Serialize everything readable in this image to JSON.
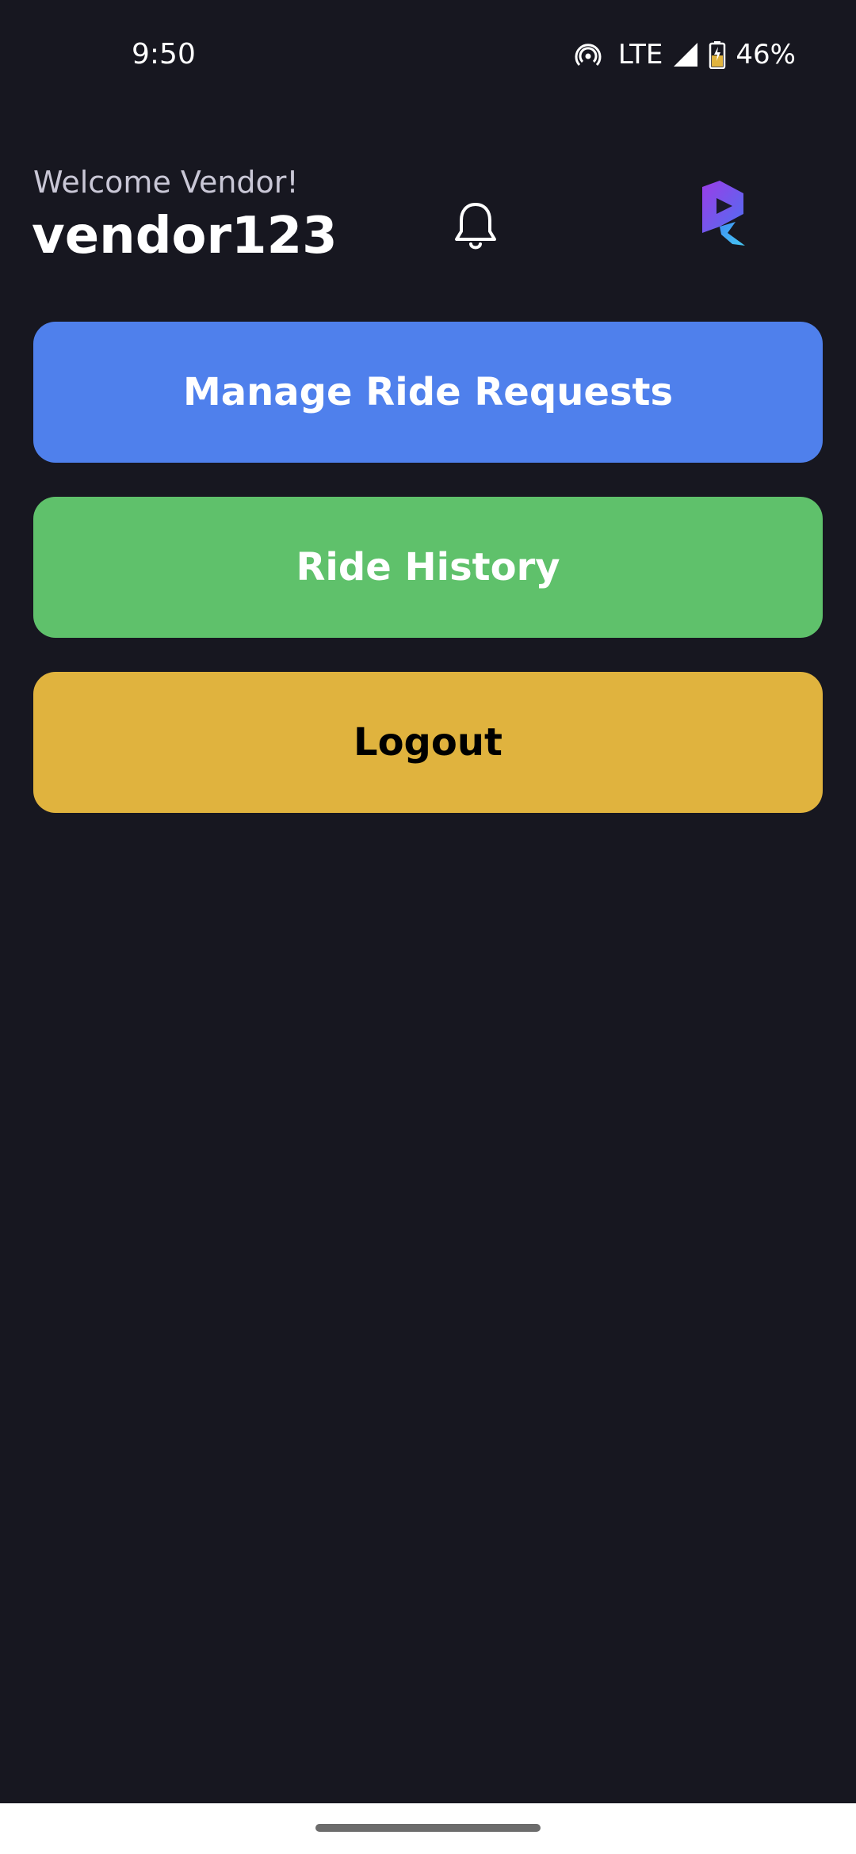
{
  "status_bar": {
    "time": "9:50",
    "network": "LTE",
    "battery": "46%",
    "icons": [
      "hotspot-icon",
      "signal-icon",
      "battery-icon"
    ]
  },
  "header": {
    "welcome": "Welcome Vendor!",
    "username": "vendor123",
    "notification_icon": "bell-icon",
    "logo_icon": "app-logo"
  },
  "actions": {
    "manage_label": "Manage Ride Requests",
    "history_label": "Ride History",
    "logout_label": "Logout"
  },
  "colors": {
    "background": "#171720",
    "manage": "#4f80ec",
    "history": "#5fc16b",
    "logout": "#e0b33e"
  }
}
